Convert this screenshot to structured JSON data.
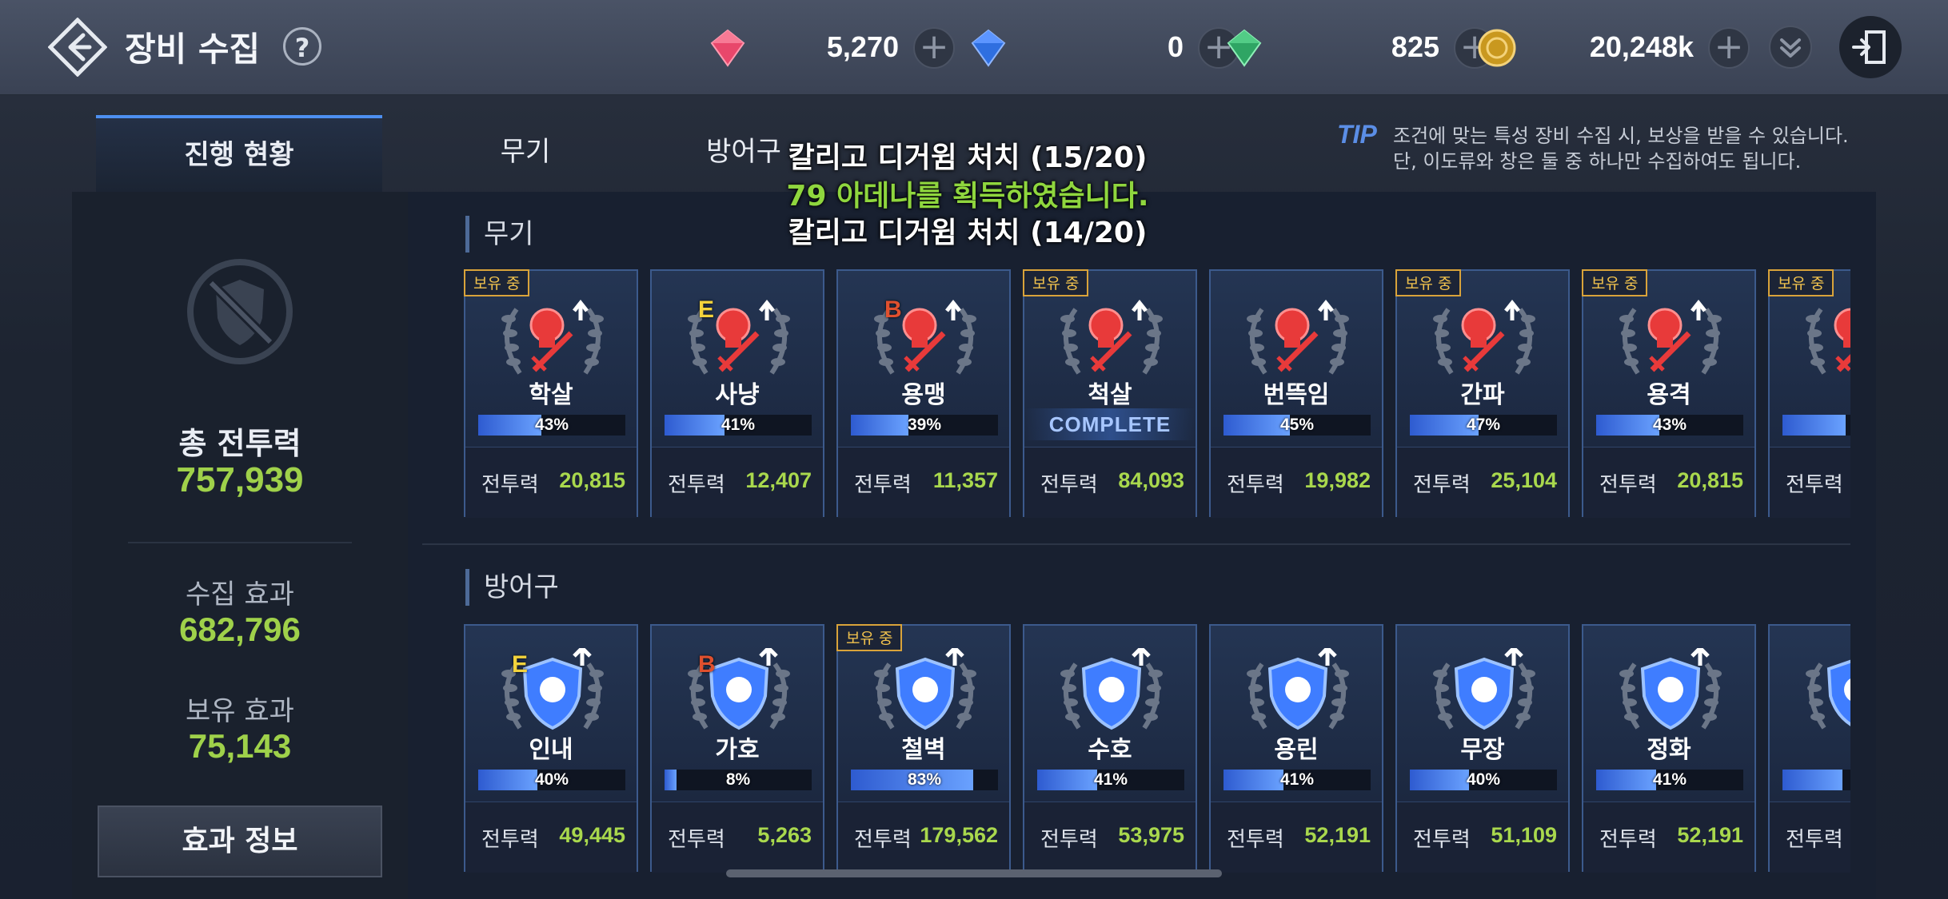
{
  "header": {
    "title": "장비 수집",
    "help": "?",
    "currencies": [
      {
        "icon": "red-gem-icon",
        "amount": "5,270"
      },
      {
        "icon": "blue-gem-icon",
        "amount": "0"
      },
      {
        "icon": "green-gem-icon",
        "amount": "825"
      },
      {
        "icon": "gold-coin-icon",
        "amount": "20,248k"
      }
    ],
    "plus": "+"
  },
  "tabs": [
    {
      "label": "진행 현황",
      "active": true
    },
    {
      "label": "무기",
      "active": false
    },
    {
      "label": "방어구",
      "active": false
    }
  ],
  "tip": {
    "label": "TIP",
    "line1": "조건에 맞는 특성 장비 수집 시, 보상을 받을 수 있습니다.",
    "line2": "단, 이도류와 창은 둘 중 하나만 수집하여도 됩니다."
  },
  "notices": [
    {
      "text": "칼리고 디거윔 처치 (15/20)"
    },
    {
      "text": "79 아데나를 획득하였습니다."
    },
    {
      "text": "칼리고 디거윔 처치 (14/20)"
    }
  ],
  "summary": {
    "total_label": "총 전투력",
    "total_value": "757,939",
    "collect_label": "수집 효과",
    "collect_value": "682,796",
    "own_label": "보유 효과",
    "own_value": "75,143",
    "effect_button": "효과 정보"
  },
  "colors": {
    "accent": "#4d8ff0",
    "value_green": "#a9d84d",
    "owned_gold": "#d9a33a",
    "grade_E": "#f3d33c",
    "grade_B": "#e0502e"
  },
  "power_label": "전투력",
  "owned_label": "보유 중",
  "weapons": {
    "title": "무기",
    "items": [
      {
        "name": "학살",
        "progress": 43,
        "pct": "43%",
        "power": "20,815",
        "owned": true,
        "grade": "",
        "icon": "skull-sword-icon",
        "complete": ""
      },
      {
        "name": "사냥",
        "progress": 41,
        "pct": "41%",
        "power": "12,407",
        "owned": false,
        "grade": "E",
        "icon": "skull-sword-icon",
        "complete": ""
      },
      {
        "name": "용맹",
        "progress": 39,
        "pct": "39%",
        "power": "11,357",
        "owned": false,
        "grade": "B",
        "icon": "skull-sword-icon",
        "complete": ""
      },
      {
        "name": "척살",
        "progress": 100,
        "pct": "",
        "power": "84,093",
        "owned": true,
        "grade": "",
        "icon": "person-sword-icon",
        "complete": "COMPLETE"
      },
      {
        "name": "번뜩임",
        "progress": 45,
        "pct": "45%",
        "power": "19,982",
        "owned": false,
        "grade": "",
        "icon": "hand-sword-icon",
        "complete": ""
      },
      {
        "name": "간파",
        "progress": 47,
        "pct": "47%",
        "power": "25,104",
        "owned": true,
        "grade": "",
        "icon": "demon-sword-icon",
        "complete": ""
      },
      {
        "name": "용격",
        "progress": 43,
        "pct": "43%",
        "power": "20,815",
        "owned": true,
        "grade": "",
        "icon": "dragon-sword-icon",
        "complete": ""
      },
      {
        "name": "",
        "progress": 43,
        "pct": "",
        "power": "",
        "owned": true,
        "grade": "",
        "icon": "figure-sword-icon",
        "complete": ""
      }
    ]
  },
  "armors": {
    "title": "방어구",
    "items": [
      {
        "name": "인내",
        "progress": 40,
        "pct": "40%",
        "power": "49,445",
        "owned": false,
        "grade": "E",
        "icon": "skull-shield-icon"
      },
      {
        "name": "가호",
        "progress": 8,
        "pct": "8%",
        "power": "5,263",
        "owned": false,
        "grade": "B",
        "icon": "skull-shield-icon"
      },
      {
        "name": "철벽",
        "progress": 83,
        "pct": "83%",
        "power": "179,562",
        "owned": true,
        "grade": "",
        "icon": "person-shield-icon"
      },
      {
        "name": "수호",
        "progress": 41,
        "pct": "41%",
        "power": "53,975",
        "owned": false,
        "grade": "",
        "icon": "demon-shield-icon"
      },
      {
        "name": "용린",
        "progress": 41,
        "pct": "41%",
        "power": "52,191",
        "owned": false,
        "grade": "",
        "icon": "dragon-shield-icon"
      },
      {
        "name": "무장",
        "progress": 40,
        "pct": "40%",
        "power": "51,109",
        "owned": false,
        "grade": "",
        "icon": "figure-shield-icon"
      },
      {
        "name": "정화",
        "progress": 41,
        "pct": "41%",
        "power": "52,191",
        "owned": false,
        "grade": "",
        "icon": "mask-shield-icon"
      },
      {
        "name": "",
        "progress": 41,
        "pct": "",
        "power": "",
        "owned": false,
        "grade": "",
        "icon": "skull-shield-icon"
      }
    ]
  }
}
